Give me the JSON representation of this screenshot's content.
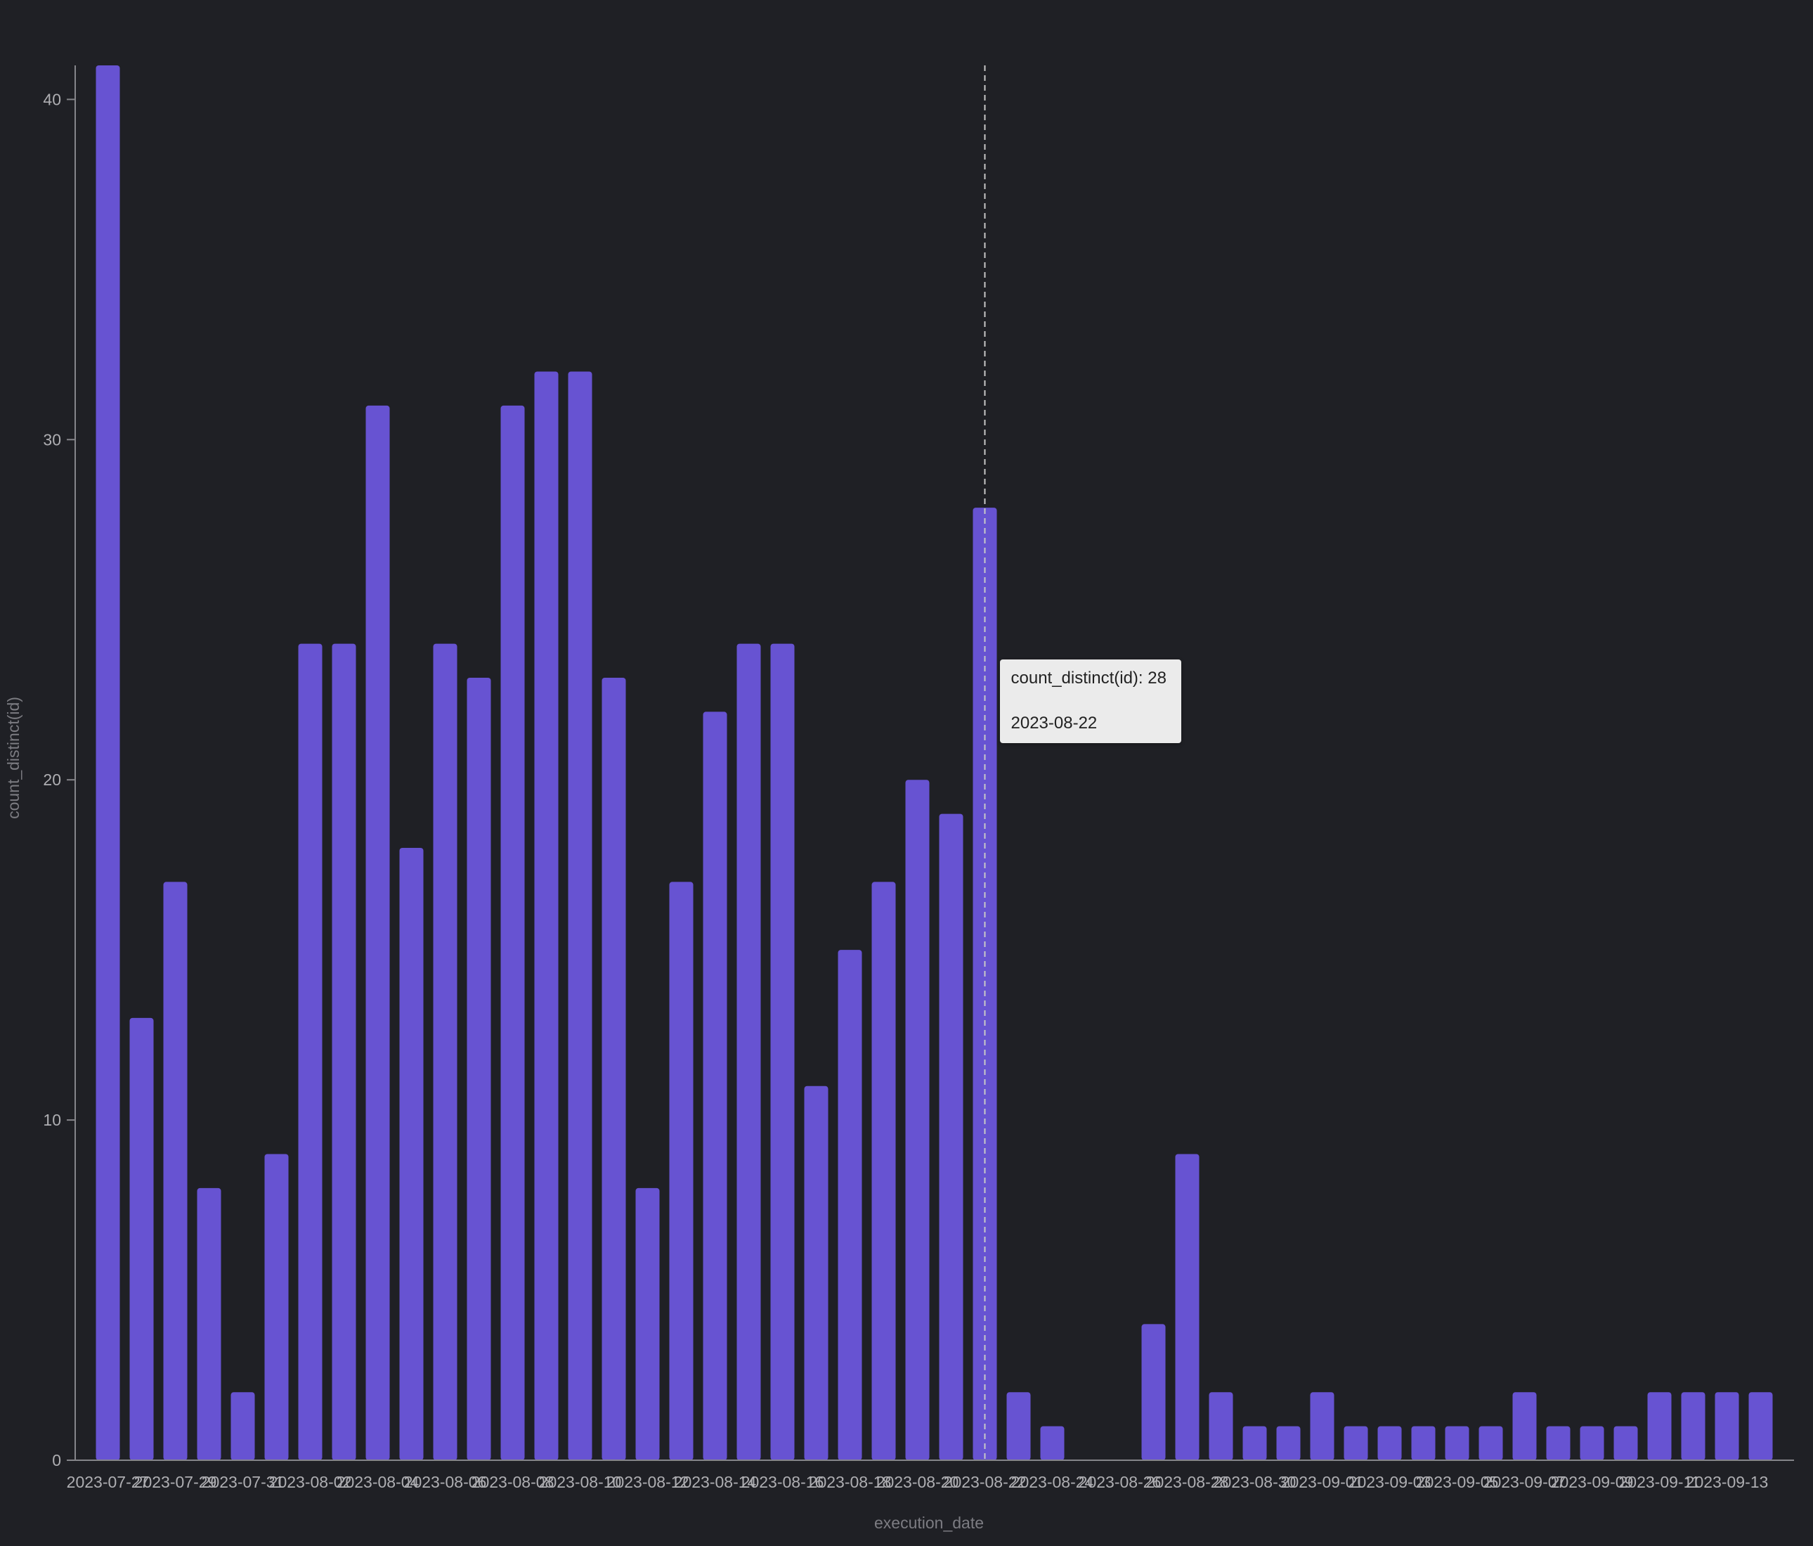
{
  "colors": {
    "background": "#1f2025",
    "bar": "#6753d2",
    "axis": "#85858a",
    "tick_text": "#aeaeb2",
    "label_text": "#7c7c82",
    "crosshair": "#c8c8c8",
    "tooltip_bg": "#ebebeb",
    "tooltip_text": "#222222"
  },
  "chart_data": {
    "type": "bar",
    "xlabel": "execution_date",
    "ylabel": "count_distinct(id)",
    "ylim": [
      0,
      41
    ],
    "yticks": [
      0,
      10,
      20,
      30,
      40
    ],
    "grid": false,
    "categories": [
      "2023-07-27",
      "2023-07-28",
      "2023-07-29",
      "2023-07-30",
      "2023-07-31",
      "2023-08-01",
      "2023-08-02",
      "2023-08-03",
      "2023-08-04",
      "2023-08-05",
      "2023-08-06",
      "2023-08-07",
      "2023-08-08",
      "2023-08-09",
      "2023-08-10",
      "2023-08-11",
      "2023-08-12",
      "2023-08-13",
      "2023-08-14",
      "2023-08-15",
      "2023-08-16",
      "2023-08-17",
      "2023-08-18",
      "2023-08-19",
      "2023-08-20",
      "2023-08-21",
      "2023-08-22",
      "2023-08-23",
      "2023-08-24",
      "2023-08-25",
      "2023-08-26",
      "2023-08-27",
      "2023-08-28",
      "2023-08-29",
      "2023-08-30",
      "2023-08-31",
      "2023-09-01",
      "2023-09-02",
      "2023-09-03",
      "2023-09-04",
      "2023-09-05",
      "2023-09-06",
      "2023-09-07",
      "2023-09-08",
      "2023-09-09",
      "2023-09-10",
      "2023-09-11",
      "2023-09-12",
      "2023-09-13",
      "2023-09-14"
    ],
    "values": [
      41,
      13,
      17,
      8,
      2,
      9,
      24,
      24,
      31,
      18,
      24,
      23,
      31,
      32,
      32,
      23,
      8,
      17,
      22,
      24,
      24,
      11,
      15,
      17,
      20,
      19,
      28,
      2,
      1,
      0,
      0,
      4,
      9,
      2,
      1,
      1,
      2,
      1,
      1,
      1,
      1,
      1,
      2,
      1,
      1,
      1,
      2,
      2,
      2,
      2
    ],
    "xtick_labels": [
      "2023-07-27",
      "2023-07-29",
      "2023-07-31",
      "2023-08-02",
      "2023-08-04",
      "2023-08-06",
      "2023-08-08",
      "2023-08-10",
      "2023-08-12",
      "2023-08-14",
      "2023-08-16",
      "2023-08-18",
      "2023-08-20",
      "2023-08-22",
      "2023-08-24",
      "2023-08-26",
      "2023-08-28",
      "2023-08-30",
      "2023-09-01",
      "2023-09-03",
      "2023-09-05",
      "2023-09-07",
      "2023-09-09",
      "2023-09-11",
      "2023-09-13"
    ],
    "hover_date": "2023-08-22"
  },
  "tooltip": {
    "value_line": "count_distinct(id): 28",
    "date_line": "2023-08-22"
  }
}
